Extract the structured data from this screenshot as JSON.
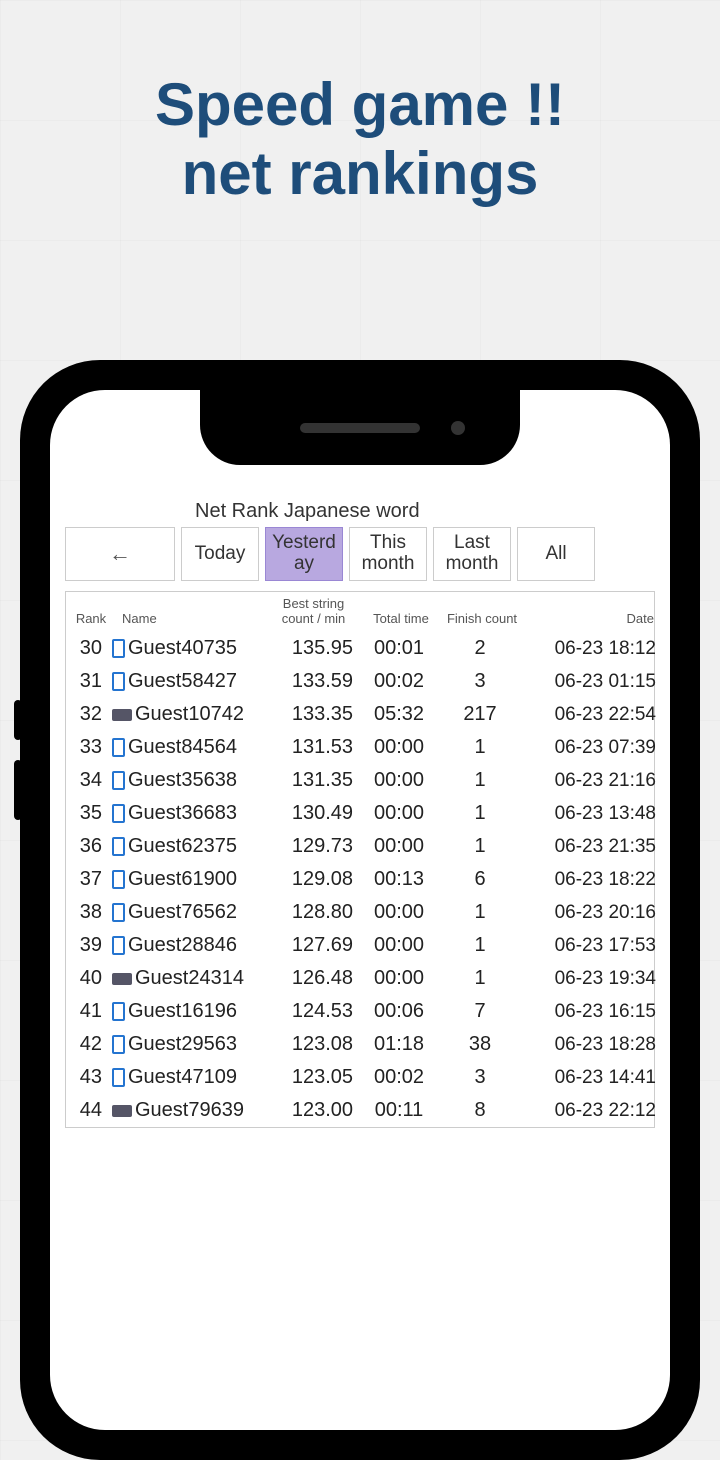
{
  "headline": {
    "line1": "Speed game !!",
    "line2": "net rankings"
  },
  "page_title": "Net Rank Japanese word",
  "back_label": "←",
  "tabs": [
    {
      "label": "Today",
      "active": false
    },
    {
      "label": "Yesterday",
      "active": true
    },
    {
      "label": "This month",
      "active": false
    },
    {
      "label": "Last month",
      "active": false
    },
    {
      "label": "All",
      "active": false
    }
  ],
  "headers": {
    "rank": "Rank",
    "name": "Name",
    "score": "Best string count / min",
    "time": "Total time",
    "finish": "Finish count",
    "date": "Date"
  },
  "rows": [
    {
      "rank": 30,
      "icon": "phone",
      "name": "Guest40735",
      "score": "135.95",
      "time": "00:01",
      "finish": 2,
      "date": "06-23 18:12"
    },
    {
      "rank": 31,
      "icon": "phone",
      "name": "Guest58427",
      "score": "133.59",
      "time": "00:02",
      "finish": 3,
      "date": "06-23 01:15"
    },
    {
      "rank": 32,
      "icon": "wide",
      "name": "Guest10742",
      "score": "133.35",
      "time": "05:32",
      "finish": 217,
      "date": "06-23 22:54"
    },
    {
      "rank": 33,
      "icon": "phone",
      "name": "Guest84564",
      "score": "131.53",
      "time": "00:00",
      "finish": 1,
      "date": "06-23 07:39"
    },
    {
      "rank": 34,
      "icon": "phone",
      "name": "Guest35638",
      "score": "131.35",
      "time": "00:00",
      "finish": 1,
      "date": "06-23 21:16"
    },
    {
      "rank": 35,
      "icon": "phone",
      "name": "Guest36683",
      "score": "130.49",
      "time": "00:00",
      "finish": 1,
      "date": "06-23 13:48"
    },
    {
      "rank": 36,
      "icon": "phone",
      "name": "Guest62375",
      "score": "129.73",
      "time": "00:00",
      "finish": 1,
      "date": "06-23 21:35"
    },
    {
      "rank": 37,
      "icon": "phone",
      "name": "Guest61900",
      "score": "129.08",
      "time": "00:13",
      "finish": 6,
      "date": "06-23 18:22"
    },
    {
      "rank": 38,
      "icon": "phone",
      "name": "Guest76562",
      "score": "128.80",
      "time": "00:00",
      "finish": 1,
      "date": "06-23 20:16"
    },
    {
      "rank": 39,
      "icon": "phone",
      "name": "Guest28846",
      "score": "127.69",
      "time": "00:00",
      "finish": 1,
      "date": "06-23 17:53"
    },
    {
      "rank": 40,
      "icon": "wide",
      "name": "Guest24314",
      "score": "126.48",
      "time": "00:00",
      "finish": 1,
      "date": "06-23 19:34"
    },
    {
      "rank": 41,
      "icon": "phone",
      "name": "Guest16196",
      "score": "124.53",
      "time": "00:06",
      "finish": 7,
      "date": "06-23 16:15"
    },
    {
      "rank": 42,
      "icon": "phone",
      "name": "Guest29563",
      "score": "123.08",
      "time": "01:18",
      "finish": 38,
      "date": "06-23 18:28"
    },
    {
      "rank": 43,
      "icon": "phone",
      "name": "Guest47109",
      "score": "123.05",
      "time": "00:02",
      "finish": 3,
      "date": "06-23 14:41"
    },
    {
      "rank": 44,
      "icon": "wide",
      "name": "Guest79639",
      "score": "123.00",
      "time": "00:11",
      "finish": 8,
      "date": "06-23 22:12"
    }
  ]
}
